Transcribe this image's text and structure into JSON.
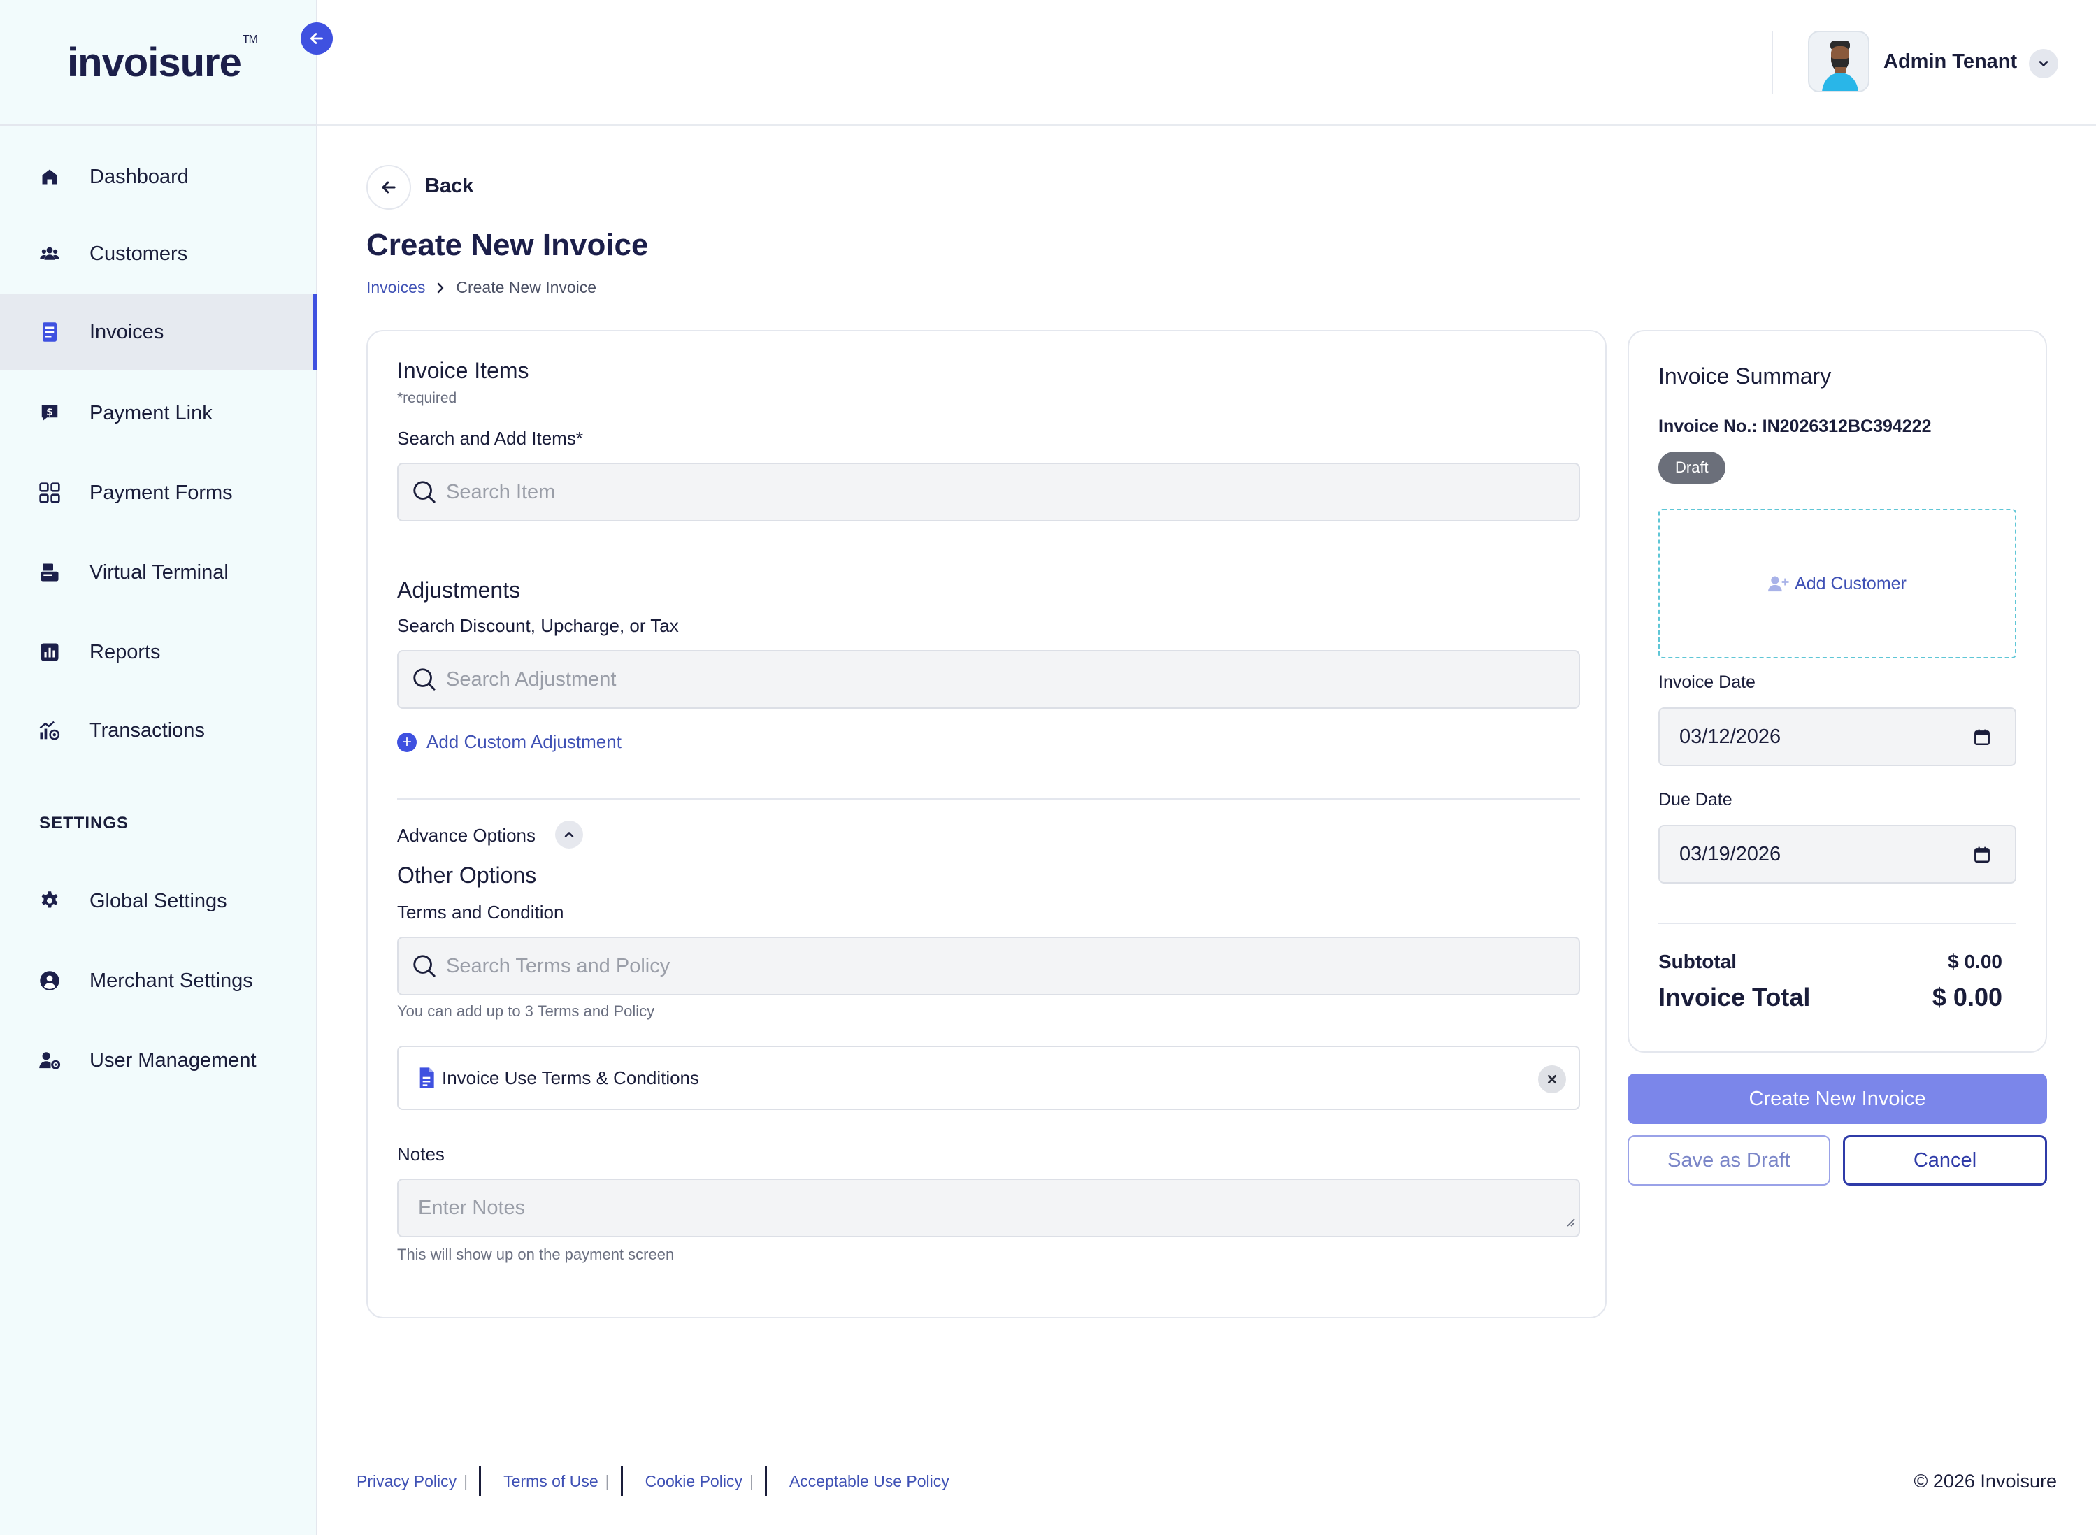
{
  "brand": {
    "name": "invoisure",
    "trademark": "TM",
    "accent": "#3f51e0"
  },
  "sidebar": {
    "items": [
      {
        "label": "Dashboard",
        "icon": "home-icon"
      },
      {
        "label": "Customers",
        "icon": "users-icon"
      },
      {
        "label": "Invoices",
        "icon": "document-icon",
        "active": true
      },
      {
        "label": "Payment Link",
        "icon": "dollar-message-icon"
      },
      {
        "label": "Payment Forms",
        "icon": "grid-icon"
      },
      {
        "label": "Virtual Terminal",
        "icon": "terminal-icon"
      },
      {
        "label": "Reports",
        "icon": "chart-icon"
      },
      {
        "label": "Transactions",
        "icon": "transactions-icon"
      }
    ],
    "settings_label": "SETTINGS",
    "settings_items": [
      {
        "label": "Global Settings",
        "icon": "gear-icon"
      },
      {
        "label": "Merchant Settings",
        "icon": "user-circle-icon"
      },
      {
        "label": "User Management",
        "icon": "user-gear-icon"
      }
    ]
  },
  "header": {
    "user_name": "Admin Tenant"
  },
  "page": {
    "back_label": "Back",
    "title": "Create New Invoice",
    "breadcrumb": [
      "Invoices",
      "Create New Invoice"
    ]
  },
  "form": {
    "items_title": "Invoice Items",
    "required_note": "*required",
    "items_label": "Search and Add Items*",
    "items_placeholder": "Search Item",
    "adjustments_title": "Adjustments",
    "adjustments_label": "Search Discount, Upcharge, or Tax",
    "adjustments_placeholder": "Search Adjustment",
    "add_custom_adjustment": "Add Custom Adjustment",
    "advance_options": "Advance Options",
    "other_options_title": "Other Options",
    "terms_label": "Terms and Condition",
    "terms_placeholder": "Search Terms and Policy",
    "terms_hint": "You can add up to 3 Terms and Policy",
    "terms_selected": "Invoice Use Terms & Conditions",
    "notes_label": "Notes",
    "notes_placeholder": "Enter Notes",
    "notes_hint": "This will show up on the payment screen"
  },
  "summary": {
    "title": "Invoice Summary",
    "invoice_no_label": "Invoice No.: IN2026312BC394222",
    "status": "Draft",
    "add_customer": "Add Customer",
    "invoice_date_label": "Invoice Date",
    "invoice_date": "03/12/2026",
    "due_date_label": "Due Date",
    "due_date": "03/19/2026",
    "subtotal_label": "Subtotal",
    "subtotal_value": "$ 0.00",
    "total_label": "Invoice Total",
    "total_value": "$ 0.00"
  },
  "actions": {
    "create": "Create New Invoice",
    "save_draft": "Save as Draft",
    "cancel": "Cancel"
  },
  "footer": {
    "links": [
      "Privacy Policy",
      "Terms of Use",
      "Cookie Policy",
      "Acceptable Use Policy"
    ],
    "pipe": "|",
    "copyright": "© 2026 Invoisure"
  }
}
